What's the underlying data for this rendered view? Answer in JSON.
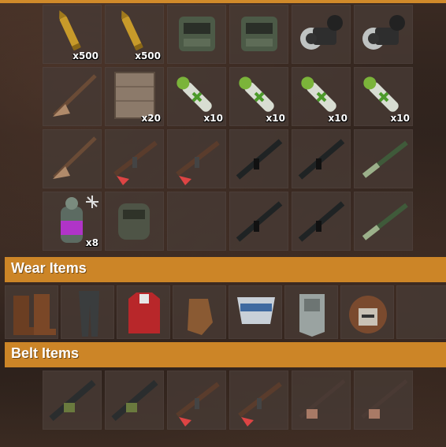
{
  "sections": {
    "wear_title": "Wear Items",
    "belt_title": "Belt Items"
  },
  "main_slots": [
    {
      "item": "rifle-ammo-icon",
      "qty": "x500"
    },
    {
      "item": "rifle-ammo-icon",
      "qty": "x500"
    },
    {
      "item": "metal-facemask-icon",
      "qty": ""
    },
    {
      "item": "metal-facemask-icon",
      "qty": ""
    },
    {
      "item": "scope-icon",
      "qty": ""
    },
    {
      "item": "scope-icon",
      "qty": ""
    },
    {
      "item": "hunting-bow-icon",
      "qty": ""
    },
    {
      "item": "stone-wall-icon",
      "qty": "x20"
    },
    {
      "item": "medical-syringe-icon",
      "qty": "x10"
    },
    {
      "item": "medical-syringe-icon",
      "qty": "x10"
    },
    {
      "item": "medical-syringe-icon",
      "qty": "x10"
    },
    {
      "item": "medical-syringe-icon",
      "qty": "x10"
    },
    {
      "item": "hunting-bow-icon",
      "qty": ""
    },
    {
      "item": "assault-rifle-icon",
      "qty": ""
    },
    {
      "item": "assault-rifle-icon",
      "qty": ""
    },
    {
      "item": "lr300-rifle-icon",
      "qty": ""
    },
    {
      "item": "lr300-rifle-icon",
      "qty": ""
    },
    {
      "item": "bolt-rifle-icon",
      "qty": ""
    },
    {
      "item": "smoke-grenade-icon",
      "qty": "x8"
    },
    {
      "item": "roadsign-gloves-icon",
      "qty": ""
    },
    {
      "item": "",
      "qty": ""
    },
    {
      "item": "lr300-rifle-icon",
      "qty": ""
    },
    {
      "item": "lr300-rifle-icon",
      "qty": ""
    },
    {
      "item": "bolt-rifle-icon",
      "qty": ""
    }
  ],
  "wear_slots": [
    {
      "item": "boots-icon"
    },
    {
      "item": "pants-icon"
    },
    {
      "item": "hoodie-icon"
    },
    {
      "item": "gloves-icon"
    },
    {
      "item": "kilt-icon"
    },
    {
      "item": "chestplate-icon"
    },
    {
      "item": "helmet-icon"
    },
    {
      "item": ""
    }
  ],
  "belt_slots": [
    {
      "item": "m249-icon"
    },
    {
      "item": "m249-icon"
    },
    {
      "item": "assault-rifle-icon"
    },
    {
      "item": "assault-rifle-icon"
    },
    {
      "item": "semi-rifle-icon"
    },
    {
      "item": "semi-rifle-icon"
    }
  ]
}
